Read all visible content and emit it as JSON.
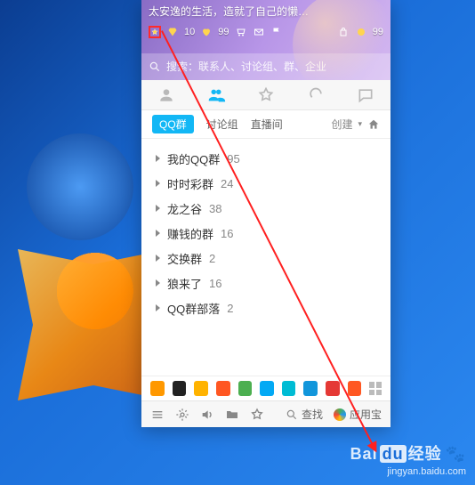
{
  "header": {
    "motto": "太安逸的生活，造就了自己的懒…",
    "level_a": "10",
    "level_b": "99",
    "coin": "99"
  },
  "search": {
    "placeholder": "搜索：联系人、讨论组、群、企业"
  },
  "sub_tabs": {
    "items": [
      "QQ群",
      "讨论组",
      "直播间"
    ],
    "create_label": "创建"
  },
  "groups": [
    {
      "name": "我的QQ群",
      "count": "95"
    },
    {
      "name": "时时彩群",
      "count": "24"
    },
    {
      "name": "龙之谷",
      "count": "38"
    },
    {
      "name": "赚钱的群",
      "count": "16"
    },
    {
      "name": "交换群",
      "count": "2"
    },
    {
      "name": "狼来了",
      "count": "16"
    },
    {
      "name": "QQ群部落",
      "count": "2"
    }
  ],
  "tray_colors": [
    "#ff9800",
    "#222",
    "#ffb300",
    "#ff5722",
    "#4caf50",
    "#03a9f4",
    "#00bcd4",
    "#1296db",
    "#e53935",
    "#ff5722"
  ],
  "bottom": {
    "search_label": "查找",
    "appstore_label": "应用宝"
  },
  "watermark": {
    "brand_a": "Bai",
    "brand_b": "du",
    "brand_c": "经验",
    "url": "jingyan.baidu.com"
  }
}
